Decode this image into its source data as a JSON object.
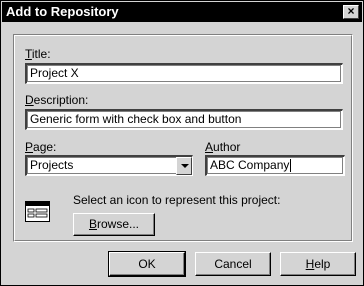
{
  "window": {
    "title": "Add to Repository",
    "close_glyph": "×"
  },
  "form": {
    "title_label_key": "T",
    "title_label_rest": "itle:",
    "title_value": "Project X",
    "description_label_key": "D",
    "description_label_rest": "escription:",
    "description_value": "Generic form with check box and button",
    "page_label_key": "P",
    "page_label_rest": "age:",
    "page_value": "Projects",
    "author_label_key": "A",
    "author_label_rest": "uthor",
    "author_value": "ABC Company",
    "icon_prompt": "Select an icon to represent this project:",
    "browse_key": "B",
    "browse_rest": "rowse...",
    "project_icon": "form-window-icon"
  },
  "buttons": {
    "ok": "OK",
    "cancel": "Cancel",
    "help_key": "H",
    "help_rest": "elp"
  }
}
